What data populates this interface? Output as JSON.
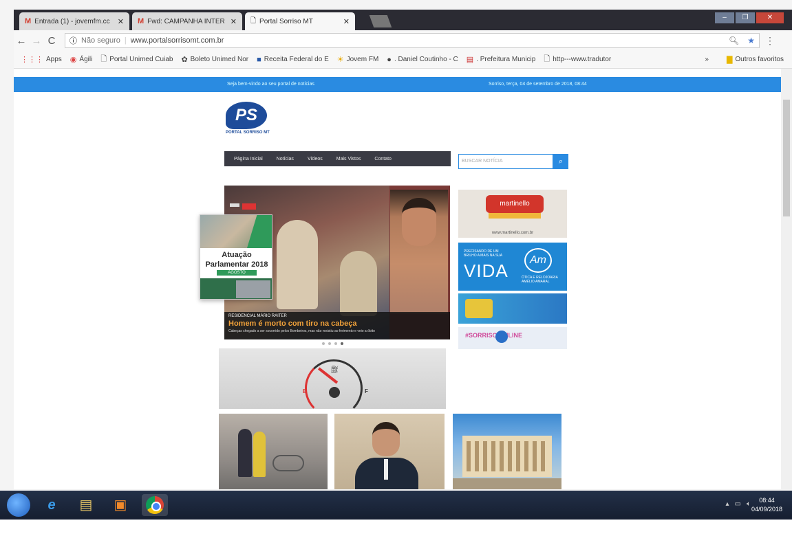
{
  "browser": {
    "tabs": [
      {
        "label": "Entrada (1) - jovemfm.cc",
        "icon": "gmail-icon"
      },
      {
        "label": "Fwd: CAMPANHA INTER",
        "icon": "gmail-icon"
      },
      {
        "label": "Portal Sorriso MT",
        "icon": "page-icon"
      }
    ],
    "address": {
      "not_secure": "Não seguro",
      "url": "www.portalsorrisomt.com.br"
    },
    "bookmarks": [
      "Apps",
      "Ágili",
      "Portal Unimed Cuiab",
      "Boleto Unimed Nor",
      "Receita Federal do E",
      "Jovem FM",
      ". Daniel Coutinho - C",
      ". Prefeitura Municip",
      "http---www.tradutor"
    ],
    "bookmarks_more": "»",
    "other_bookmarks": "Outros favoritos"
  },
  "site": {
    "topbar_left": "Seja bem-vindo ao seu portal de notícias",
    "topbar_right": "Sorriso, terça, 04 de setembro de 2018, 08:44",
    "logo_text": "PS",
    "logo_sub": "PORTAL SORRISO MT",
    "nav": [
      "Página Inicial",
      "Notícias",
      "Vídeos",
      "Mais Vistos",
      "Contato"
    ],
    "search_placeholder": "BUSCAR NOTÍCIA",
    "slide": {
      "kicker": "RESIDENCIAL MÁRIO RAITER",
      "title": "Homem é morto com tiro na cabeça",
      "summary": "Cabeças chegado a ser socorrido pelos Bombeiros, mas não resistiu ao ferimento e veio a óbito"
    },
    "popup": {
      "line1": "Atuação",
      "line2": "Parlamentar 2018",
      "month": "AGOSTO"
    },
    "ads": {
      "ad1_brand": "martinello",
      "ad1_url": "www.martinello.com.br",
      "ad2_small": "PRECISANDO DE UM BRILHO A MAIS NA SUA",
      "ad2_big": "VIDA",
      "ad2_logo": "Am",
      "ad2_tag": "ÓTICA E RELOJOARIA AMÉLIO AMARAL",
      "ad4_hash": "#SORRISO ONLINE"
    },
    "gauge": {
      "empty": "E",
      "full": "F"
    }
  },
  "taskbar": {
    "time": "08:44",
    "date": "04/09/2018"
  }
}
